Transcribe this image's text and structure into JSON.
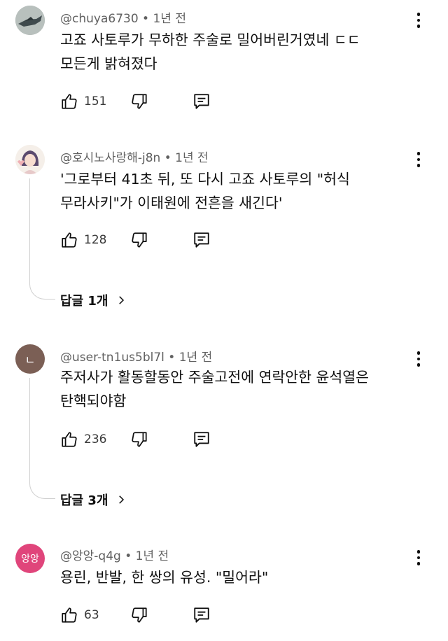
{
  "comments": [
    {
      "handle": "@chuya6730",
      "time": "1년 전",
      "text": "고죠 사토루가 무하한 주술로 밀어버린거였네 ㄷㄷ\n모든게 밝혀졌다",
      "likes": "151",
      "avatar_bg": "#9aa3a0"
    },
    {
      "handle": "@호시노사랑해-j8n",
      "time": "1년 전",
      "text": "'그로부터 41초 뒤, 또 다시 고죠 사토루의  \"허식\n무라사키\"가 이태원에 전흔을 새긴다'",
      "likes": "128",
      "replies": "답글 1개",
      "avatar_bg": "#f3ece6"
    },
    {
      "handle": "@user-tn1us5bl7l",
      "time": "1년 전",
      "text": "주저사가 활동할동안 주술고전에 연락안한 윤석열은\n탄핵되야함",
      "likes": "236",
      "replies": "답글 3개",
      "avatar_bg": "#7b5f55",
      "avatar_letter": "ㄴ"
    },
    {
      "handle": "@앙앙-q4g",
      "time": "1년 전",
      "text": "용린,  반발,  한  쌍의 유성. \"밀어라\"",
      "likes": "63",
      "avatar_bg": "#e0457b",
      "avatar_letter": "앙앙"
    }
  ]
}
